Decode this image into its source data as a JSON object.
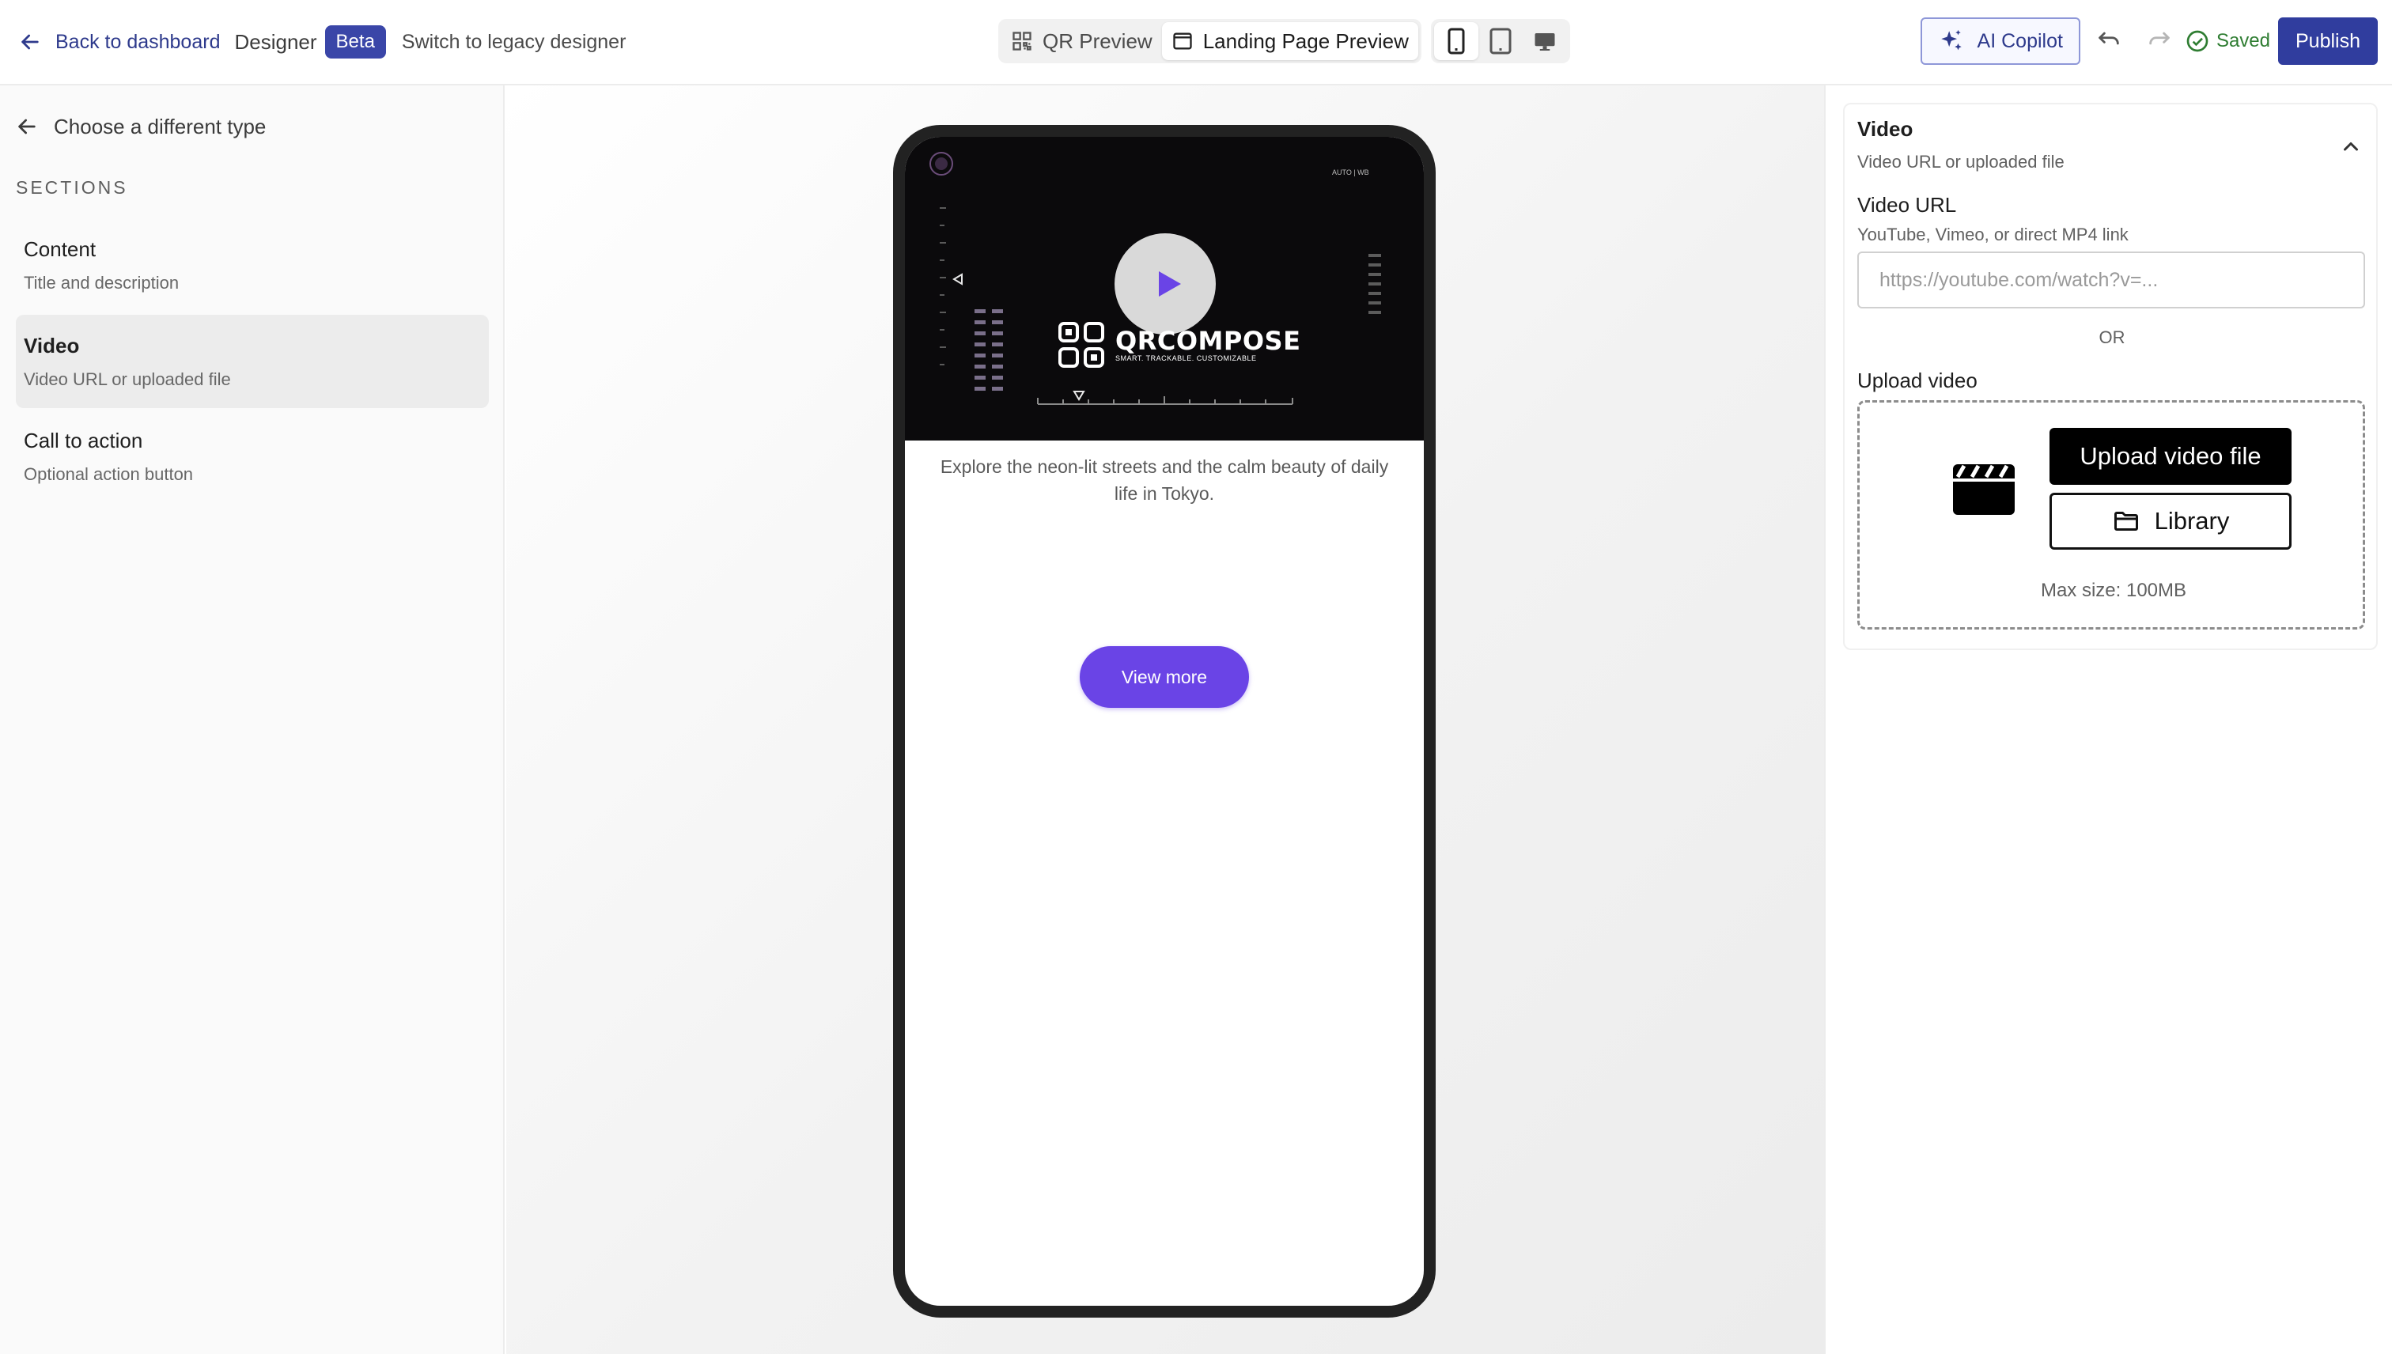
{
  "topbar": {
    "back_label": "Back to dashboard",
    "designer_label": "Designer",
    "beta_badge": "Beta",
    "legacy_link": "Switch to legacy designer",
    "preview_tabs": [
      {
        "label": "QR Preview",
        "icon": "qr-icon",
        "active": false
      },
      {
        "label": "Landing Page Preview",
        "icon": "browser-window-icon",
        "active": true
      }
    ],
    "devices": [
      {
        "icon": "phone-icon",
        "active": true
      },
      {
        "icon": "tablet-icon",
        "active": false
      },
      {
        "icon": "desktop-icon",
        "active": false
      }
    ],
    "copilot_label": "AI Copilot",
    "saved_label": "Saved",
    "publish_label": "Publish"
  },
  "sidebar": {
    "choose_label": "Choose a different type",
    "sections_heading": "SECTIONS",
    "items": [
      {
        "title": "Content",
        "subtitle": "Title and description",
        "active": false
      },
      {
        "title": "Video",
        "subtitle": "Video URL or uploaded file",
        "active": true
      },
      {
        "title": "Call to action",
        "subtitle": "Optional action button",
        "active": false
      }
    ]
  },
  "preview": {
    "video_brand": "QRCOMPOSE",
    "video_tagline": "SMART. TRACKABLE. CUSTOMIZABLE",
    "video_hud_text": "AUTO | WB",
    "description": "Explore the neon-lit streets and the calm beauty of daily life in Tokyo.",
    "cta_label": "View more"
  },
  "panel": {
    "title": "Video",
    "subtitle": "Video URL or uploaded file",
    "url_label": "Video URL",
    "url_hint": "YouTube, Vimeo, or direct MP4 link",
    "url_placeholder": "https://youtube.com/watch?v=...",
    "url_value": "",
    "or_label": "OR",
    "upload_label": "Upload video",
    "upload_button": "Upload video file",
    "library_button": "Library",
    "max_size": "Max size: 100MB"
  },
  "colors": {
    "brand": "#303d9e",
    "cta": "#6a44e6",
    "saved": "#2f7d32"
  }
}
